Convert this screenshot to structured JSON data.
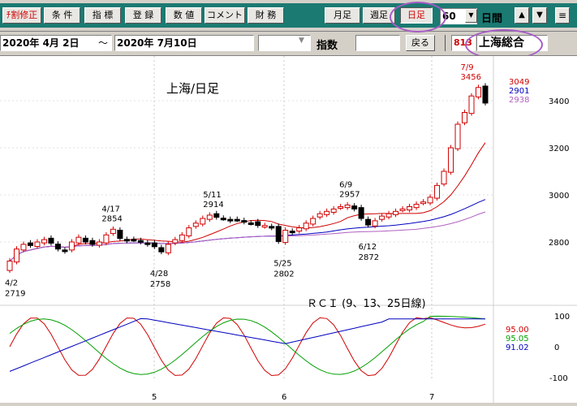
{
  "toolbar": {
    "buttons": [
      {
        "label": "ﾁ割修正",
        "red": true
      },
      {
        "label": "条 件"
      },
      {
        "label": "指 標"
      },
      {
        "label": "登 録"
      },
      {
        "label": "数 値"
      },
      {
        "label": "コメント"
      },
      {
        "label": "財 務"
      }
    ],
    "period_buttons": [
      "月足",
      "週足",
      "日足"
    ],
    "count_value": "60",
    "count_unit": "日間",
    "arrow_up": "▲",
    "arrow_down": "▼",
    "menu": "≡"
  },
  "range": {
    "from": "2020年 4月 2日",
    "tilde": "～",
    "to": "2020年 7月10日",
    "label": "指数",
    "back_button": "戻る",
    "code": "813",
    "name": "上海総合"
  },
  "chart_data": {
    "type": "candlestick",
    "title": "上海/日足",
    "x_ticks": [
      "5",
      "6",
      "7"
    ],
    "y_ticks": [
      "3400",
      "3200",
      "3000",
      "2800"
    ],
    "candles_close_approx": [
      2719,
      2770,
      2790,
      2785,
      2800,
      2810,
      2795,
      2770,
      2760,
      2800,
      2820,
      2800,
      2790,
      2800,
      2830,
      2854,
      2815,
      2805,
      2810,
      2800,
      2790,
      2780,
      2758,
      2790,
      2810,
      2830,
      2860,
      2880,
      2900,
      2914,
      2905,
      2900,
      2890,
      2895,
      2885,
      2880,
      2870,
      2870,
      2860,
      2802,
      2850,
      2840,
      2860,
      2880,
      2900,
      2920,
      2930,
      2940,
      2950,
      2957,
      2940,
      2900,
      2872,
      2890,
      2910,
      2920,
      2930,
      2940,
      2950,
      2960,
      2970,
      2990,
      3040,
      3100,
      3200,
      3300,
      3350,
      3420,
      3456,
      3390
    ],
    "annotations": [
      {
        "date": "4/2",
        "value": "2719"
      },
      {
        "date": "4/17",
        "value": "2854"
      },
      {
        "date": "4/28",
        "value": "2758"
      },
      {
        "date": "5/11",
        "value": "2914"
      },
      {
        "date": "5/25",
        "value": "2802"
      },
      {
        "date": "6/9",
        "value": "2957"
      },
      {
        "date": "6/12",
        "value": "2872"
      },
      {
        "date": "7/9",
        "value": "3456"
      }
    ],
    "ma_values": [
      {
        "label": "3049",
        "color": "#d00000"
      },
      {
        "label": "2901",
        "color": "#0000c0"
      },
      {
        "label": "2938",
        "color": "#b060c0"
      }
    ],
    "rci": {
      "title": "ＲＣＩ (9、13、25日線)",
      "y_ticks": [
        "100",
        "0",
        "-100"
      ],
      "values": [
        {
          "label": "95.00",
          "color": "#d00000"
        },
        {
          "label": "95.05",
          "color": "#00a000"
        },
        {
          "label": "91.02",
          "color": "#0000c0"
        }
      ]
    }
  }
}
